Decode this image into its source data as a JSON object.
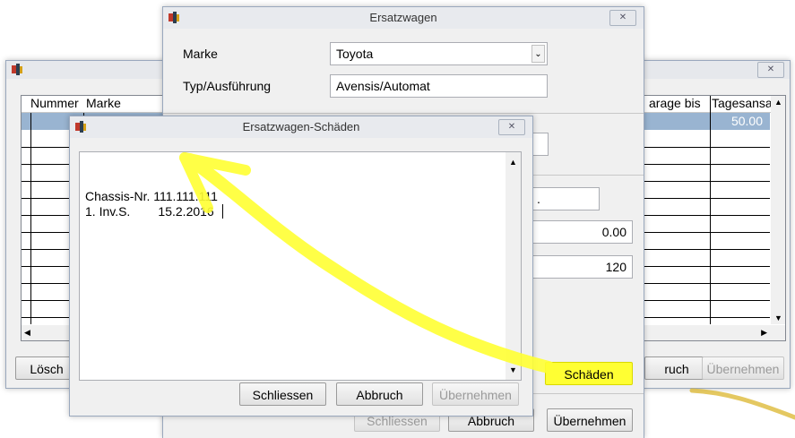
{
  "bg_window": {
    "columns": [
      "Nummer",
      "Marke"
    ],
    "right_columns": [
      "arage bis",
      "Tagesansa"
    ],
    "first_row_value": "50.00",
    "delete_label": "Lösch",
    "right_buttons": [
      "ruch",
      "Übernehmen"
    ]
  },
  "ersatzwagen": {
    "title": "Ersatzwagen",
    "marke_label": "Marke",
    "marke_value": "Toyota",
    "typ_label": "Typ/Ausführung",
    "typ_value": "Avensis/Automat",
    "partial_value": ".",
    "value1": "0.00",
    "value2": "120",
    "schaeden_label": "Schäden",
    "schliessen_label": "Schliessen",
    "abbruch_label": "Abbruch",
    "uebernehmen_label": "Übernehmen"
  },
  "schaeden_dialog": {
    "title": "Ersatzwagen-Schäden",
    "text_line1": "Chassis-Nr. 111.111.111",
    "text_line2": "1. Inv.S.        15.2.2016",
    "schliessen_label": "Schliessen",
    "abbruch_label": "Abbruch",
    "uebernehmen_label": "Übernehmen"
  },
  "icons": {
    "app": "app-icon",
    "close": "close-icon",
    "scroll": "chevron-icon"
  },
  "colors": {
    "highlight": "#ffff00",
    "selected_row": "#99b4d1",
    "border": "#abadb3"
  }
}
